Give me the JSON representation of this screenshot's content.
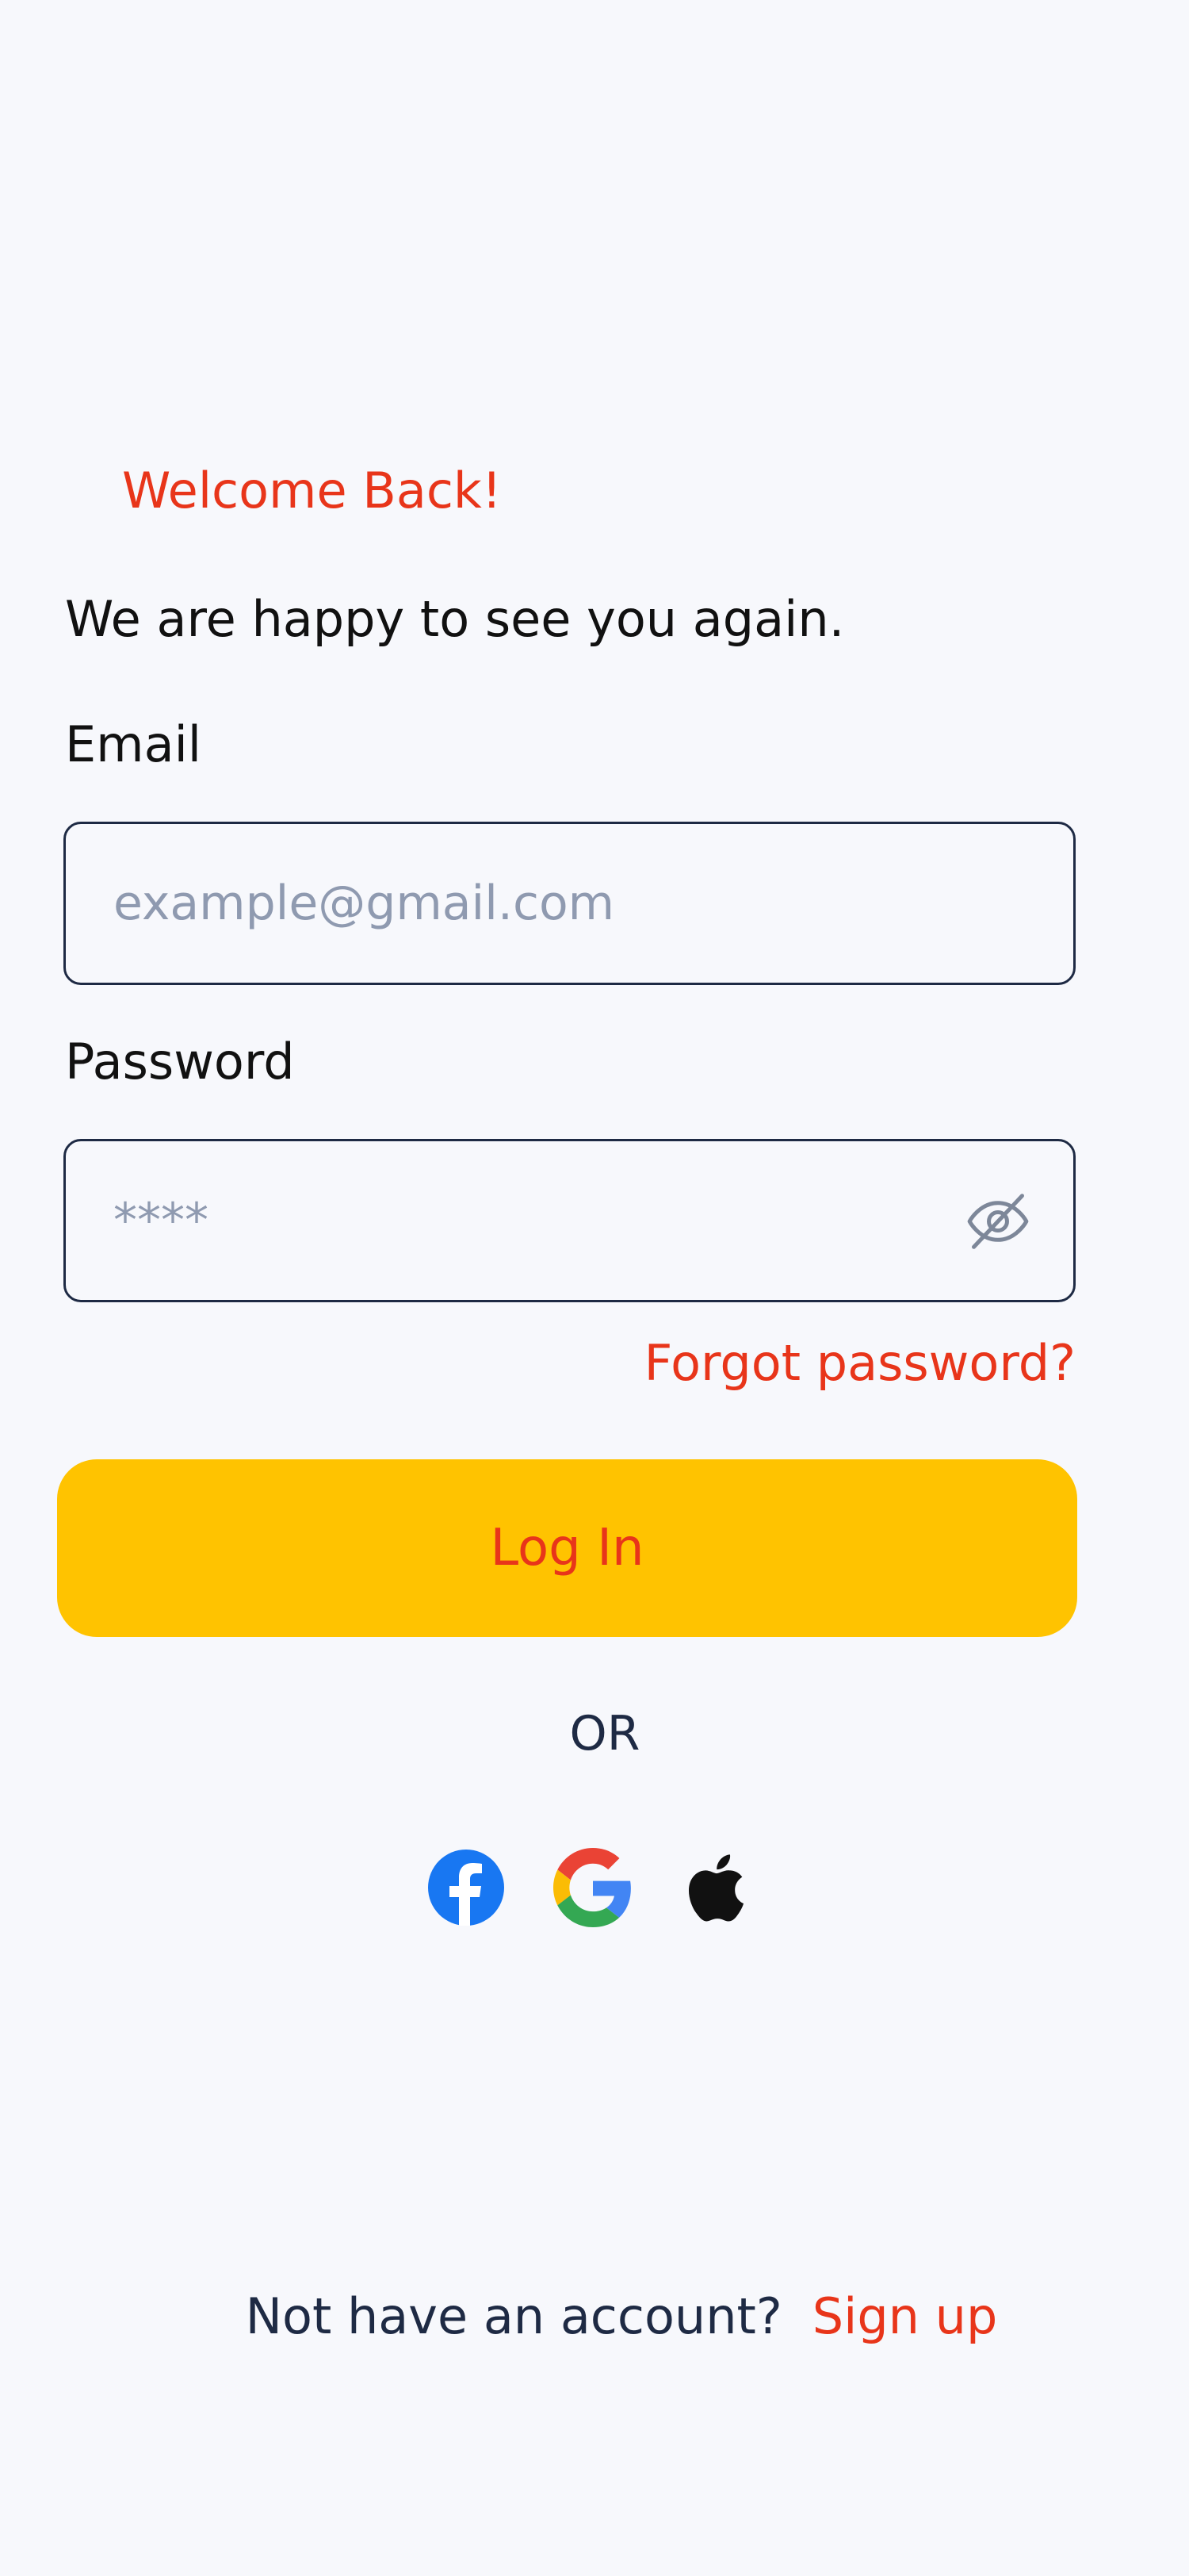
{
  "header": {
    "title": "Welcome Back!",
    "subtitle": "We are happy to see you again."
  },
  "form": {
    "email": {
      "label": "Email",
      "value": "",
      "placeholder": "example@gmail.com"
    },
    "password": {
      "label": "Password",
      "value": "",
      "placeholder": "****",
      "toggle_icon": "eye-off-icon"
    },
    "forgot_label": "Forgot password?",
    "login_label": "Log In"
  },
  "divider": {
    "label": "OR"
  },
  "social": [
    {
      "name": "facebook",
      "icon": "facebook-icon",
      "color": "#1877f2"
    },
    {
      "name": "google",
      "icon": "google-icon",
      "color": "#4285f4"
    },
    {
      "name": "apple",
      "icon": "apple-icon",
      "color": "#111111"
    }
  ],
  "footer": {
    "prompt": "Not have an account?",
    "signup_label": "Sign up"
  },
  "colors": {
    "accent": "#e8351a",
    "button": "#ffc300",
    "background": "#f7f8fc",
    "border": "#1e2a44"
  }
}
